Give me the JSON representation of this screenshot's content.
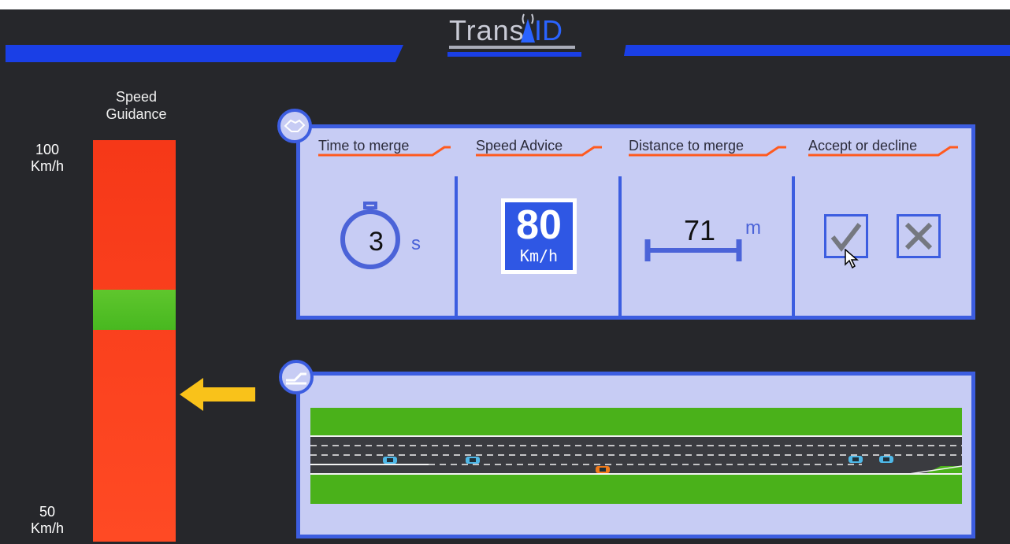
{
  "header": {
    "logo_text_part1": "Trans",
    "logo_text_part2": "ID",
    "accent_color": "#1a3fe6"
  },
  "speed_guidance": {
    "title": "Speed Guidance",
    "top_label": "100 Km/h",
    "bottom_label": "50 Km/h",
    "green_band_range": "indicator",
    "bar_color": "#f63818",
    "band_color": "#5fc62d",
    "arrow_color": "#f9c21a"
  },
  "merge_panel": {
    "columns": [
      {
        "title": "Time to merge"
      },
      {
        "title": "Speed Advice"
      },
      {
        "title": "Distance to merge"
      },
      {
        "title": "Accept or decline"
      }
    ],
    "time_to_merge": {
      "value": "3",
      "unit": "s"
    },
    "speed_advice": {
      "value": "80",
      "unit": "Km/h"
    },
    "distance_to_merge": {
      "value": "71",
      "unit": "m"
    },
    "accept_icon": "checkmark-icon",
    "decline_icon": "cross-icon"
  },
  "road_panel": {
    "road_color": "#3a3b40",
    "grass_color": "#4ab11a",
    "cars": [
      "blue-car",
      "blue-car",
      "orange-car",
      "blue-car",
      "blue-car"
    ]
  }
}
